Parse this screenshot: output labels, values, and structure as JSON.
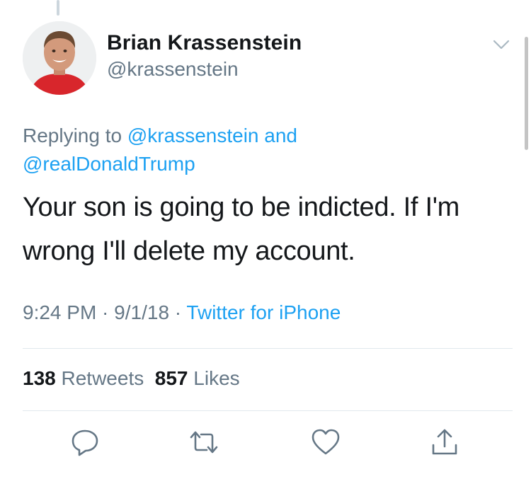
{
  "author": {
    "display_name": "Brian Krassenstein",
    "handle": "@krassenstein"
  },
  "reply": {
    "prefix": "Replying to ",
    "mention_1": "@krassenstein",
    "joiner": " and",
    "mention_2": "@realDonaldTrump"
  },
  "tweet": {
    "text_line_1": "Your son is going to be indicted. If I'm",
    "text_line_2": "wrong I'll delete my account."
  },
  "meta": {
    "time": "9:24 PM",
    "sep_1": " · ",
    "date": "9/1/18",
    "sep_2": " · ",
    "source": "Twitter for iPhone"
  },
  "stats": {
    "retweets_count": "138",
    "retweets_label": "Retweets",
    "likes_count": "857",
    "likes_label": "Likes"
  },
  "actions": [
    {
      "icon": "reply-icon"
    },
    {
      "icon": "retweet-icon"
    },
    {
      "icon": "like-icon"
    },
    {
      "icon": "share-icon"
    }
  ],
  "colors": {
    "link": "#1da1f2",
    "secondary_text": "#657786",
    "primary_text": "#14171a",
    "divider": "#e1e8ed"
  }
}
